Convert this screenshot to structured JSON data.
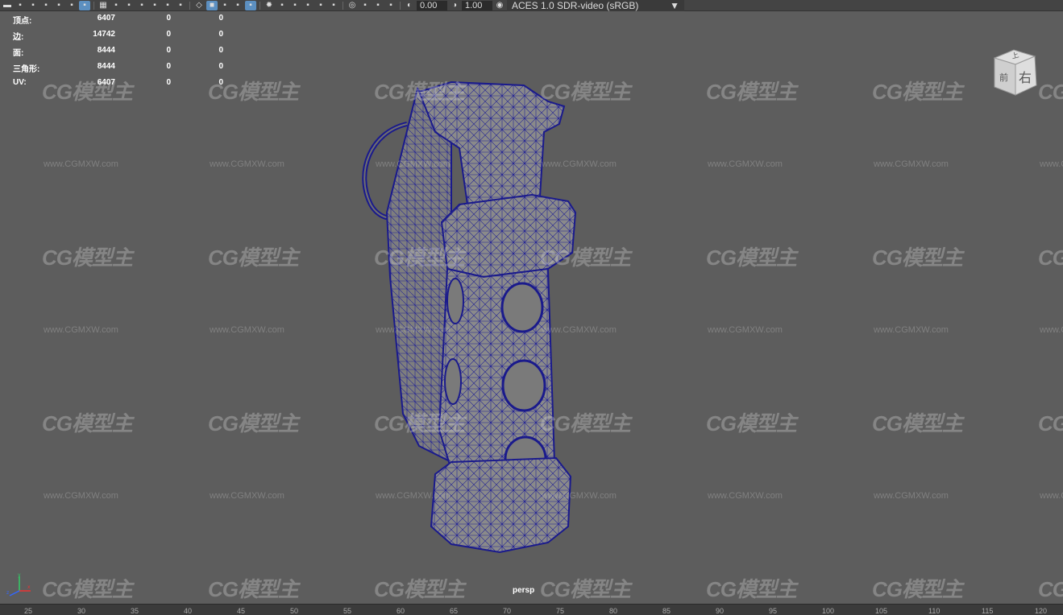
{
  "toolbar": {
    "icons": [
      "camera-icon",
      "camera-attr-icon",
      "camera-bookmark-icon",
      "bookmark-icon",
      "image-plane-icon",
      "2d-pan-icon",
      "grease-pencil-icon",
      "grid-icon",
      "film-gate-icon",
      "resolution-gate-icon",
      "gate-mask-icon",
      "field-chart-icon",
      "safe-action-icon",
      "safe-title-icon",
      "wireframe-icon",
      "smooth-shade-icon",
      "default-material-icon",
      "wireframe-on-shaded-icon",
      "textured-icon",
      "lights-icon",
      "shadows-icon",
      "screen-space-ao-icon",
      "motion-blur-icon",
      "anti-aliasing-icon",
      "depth-of-field-icon",
      "isolate-select-icon",
      "xray-icon",
      "xray-joints-icon",
      "xray-active-icon",
      "exposure-icon",
      "gamma-icon",
      "color-management-icon"
    ],
    "exposure_value": "0.00",
    "gamma_value": "1.00",
    "color_space": "ACES 1.0 SDR-video (sRGB)",
    "aces_badge": "ACES"
  },
  "hud": [
    {
      "label": "顶点:",
      "v1": "6407",
      "v2": "0",
      "v3": "0"
    },
    {
      "label": "边:",
      "v1": "14742",
      "v2": "0",
      "v3": "0"
    },
    {
      "label": "面:",
      "v1": "8444",
      "v2": "0",
      "v3": "0"
    },
    {
      "label": "三角形:",
      "v1": "8444",
      "v2": "0",
      "v3": "0"
    },
    {
      "label": "UV:",
      "v1": "6407",
      "v2": "0",
      "v3": "0"
    }
  ],
  "viewcube": {
    "top": "上",
    "front": "前",
    "right": "右"
  },
  "watermark": {
    "logo": "CG模型主",
    "url": "www.CGMXW.com"
  },
  "camera_label": "persp",
  "axis": {
    "x": "x",
    "y": "y",
    "z": "z"
  },
  "ruler_ticks": [
    "25",
    "30",
    "35",
    "40",
    "45",
    "50",
    "55",
    "60",
    "65",
    "70",
    "75",
    "80",
    "85",
    "90",
    "95",
    "100",
    "105",
    "110",
    "115",
    "120"
  ],
  "colors": {
    "viewport": "#5d5d5d",
    "wireframe": "#1a1a8c",
    "mesh": "#8a8a8a",
    "toolbar": "#444444"
  }
}
